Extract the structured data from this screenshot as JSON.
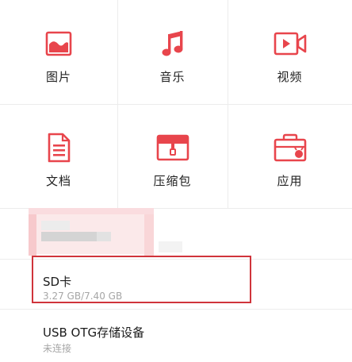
{
  "categories": [
    {
      "label": "图片",
      "icon": "image-icon"
    },
    {
      "label": "音乐",
      "icon": "music-icon"
    },
    {
      "label": "视频",
      "icon": "video-icon"
    },
    {
      "label": "文档",
      "icon": "document-icon"
    },
    {
      "label": "压缩包",
      "icon": "archive-icon"
    },
    {
      "label": "应用",
      "icon": "app-package-icon"
    }
  ],
  "storage": [
    {
      "name": "SD卡",
      "detail": "3.27 GB/7.40 GB"
    },
    {
      "name": "USB OTG存储设备",
      "detail": "未连接"
    }
  ],
  "colors": {
    "accent": "#e8454c",
    "highlight_border": "#d0343b",
    "divider": "#ececec",
    "text_primary": "#222222",
    "text_secondary": "#a6a6a6"
  }
}
